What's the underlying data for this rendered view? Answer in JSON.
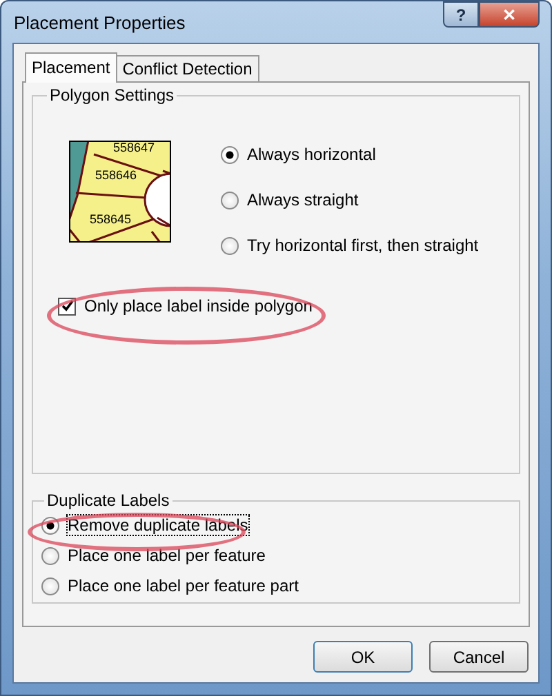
{
  "window": {
    "title": "Placement Properties",
    "controls": [
      {
        "kind": "help",
        "label": "?"
      },
      {
        "kind": "close",
        "label": "✕"
      }
    ]
  },
  "tabs": [
    {
      "label": "Placement",
      "selected": true
    },
    {
      "label": "Conflict Detection",
      "selected": false
    }
  ],
  "polygon_settings": {
    "title": "Polygon Settings",
    "preview": {
      "labels": [
        "558647",
        "558646",
        "558645"
      ]
    },
    "options": [
      {
        "label": "Always horizontal",
        "selected": true
      },
      {
        "label": "Always straight",
        "selected": false
      },
      {
        "label": "Try horizontal first, then straight",
        "selected": false
      }
    ],
    "inside_polygon": {
      "label": "Only place label inside polygon",
      "checked": true
    }
  },
  "duplicate_labels": {
    "title": "Duplicate Labels",
    "options": [
      {
        "label": "Remove duplicate labels",
        "selected": true
      },
      {
        "label": "Place one label per feature",
        "selected": false
      },
      {
        "label": "Place one label per feature part",
        "selected": false
      }
    ]
  },
  "buttons": [
    "OK",
    "Cancel"
  ]
}
